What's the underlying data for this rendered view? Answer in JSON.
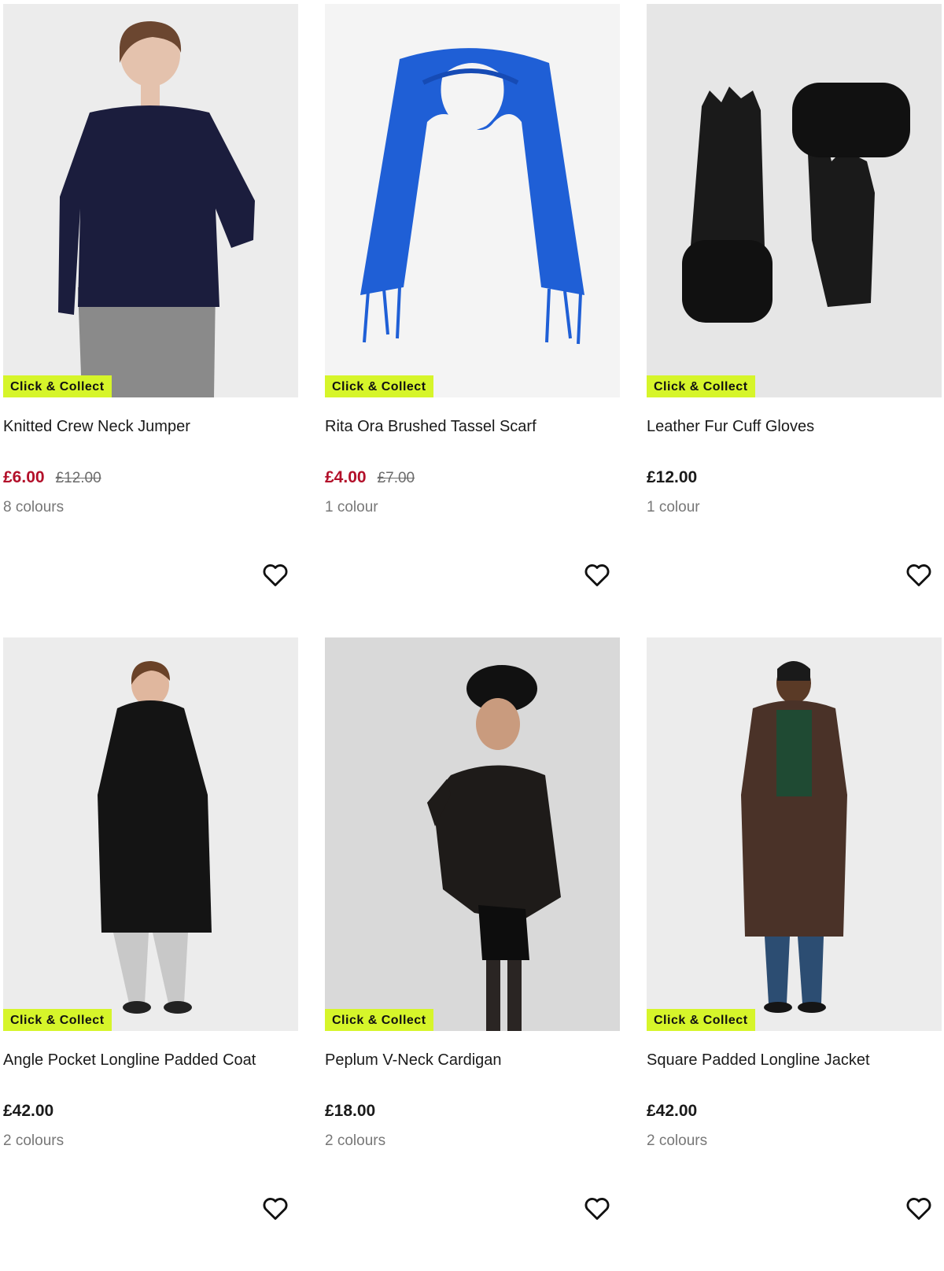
{
  "products": [
    {
      "name": "Knitted Crew Neck Jumper",
      "badge": "Click & Collect",
      "price": "£6.00",
      "was": "£12.00",
      "colours": "8 colours",
      "on_sale": true
    },
    {
      "name": "Rita Ora Brushed Tassel Scarf",
      "badge": "Click & Collect",
      "price": "£4.00",
      "was": "£7.00",
      "colours": "1 colour",
      "on_sale": true
    },
    {
      "name": "Leather Fur Cuff Gloves",
      "badge": "Click & Collect",
      "price": "£12.00",
      "was": "",
      "colours": "1 colour",
      "on_sale": false
    },
    {
      "name": "Angle Pocket Longline Padded Coat",
      "badge": "Click & Collect",
      "price": "£42.00",
      "was": "",
      "colours": "2 colours",
      "on_sale": false
    },
    {
      "name": "Peplum V-Neck Cardigan",
      "badge": "Click & Collect",
      "price": "£18.00",
      "was": "",
      "colours": "2 colours",
      "on_sale": false
    },
    {
      "name": "Square Padded Longline Jacket",
      "badge": "Click & Collect",
      "price": "£42.00",
      "was": "",
      "colours": "2 colours",
      "on_sale": false
    }
  ],
  "colors": {
    "badge_bg": "#d6f52a",
    "sale_price": "#b3102a",
    "image_bg": "#eeeeee"
  },
  "icons": {
    "favourite": "heart-outline-icon"
  }
}
